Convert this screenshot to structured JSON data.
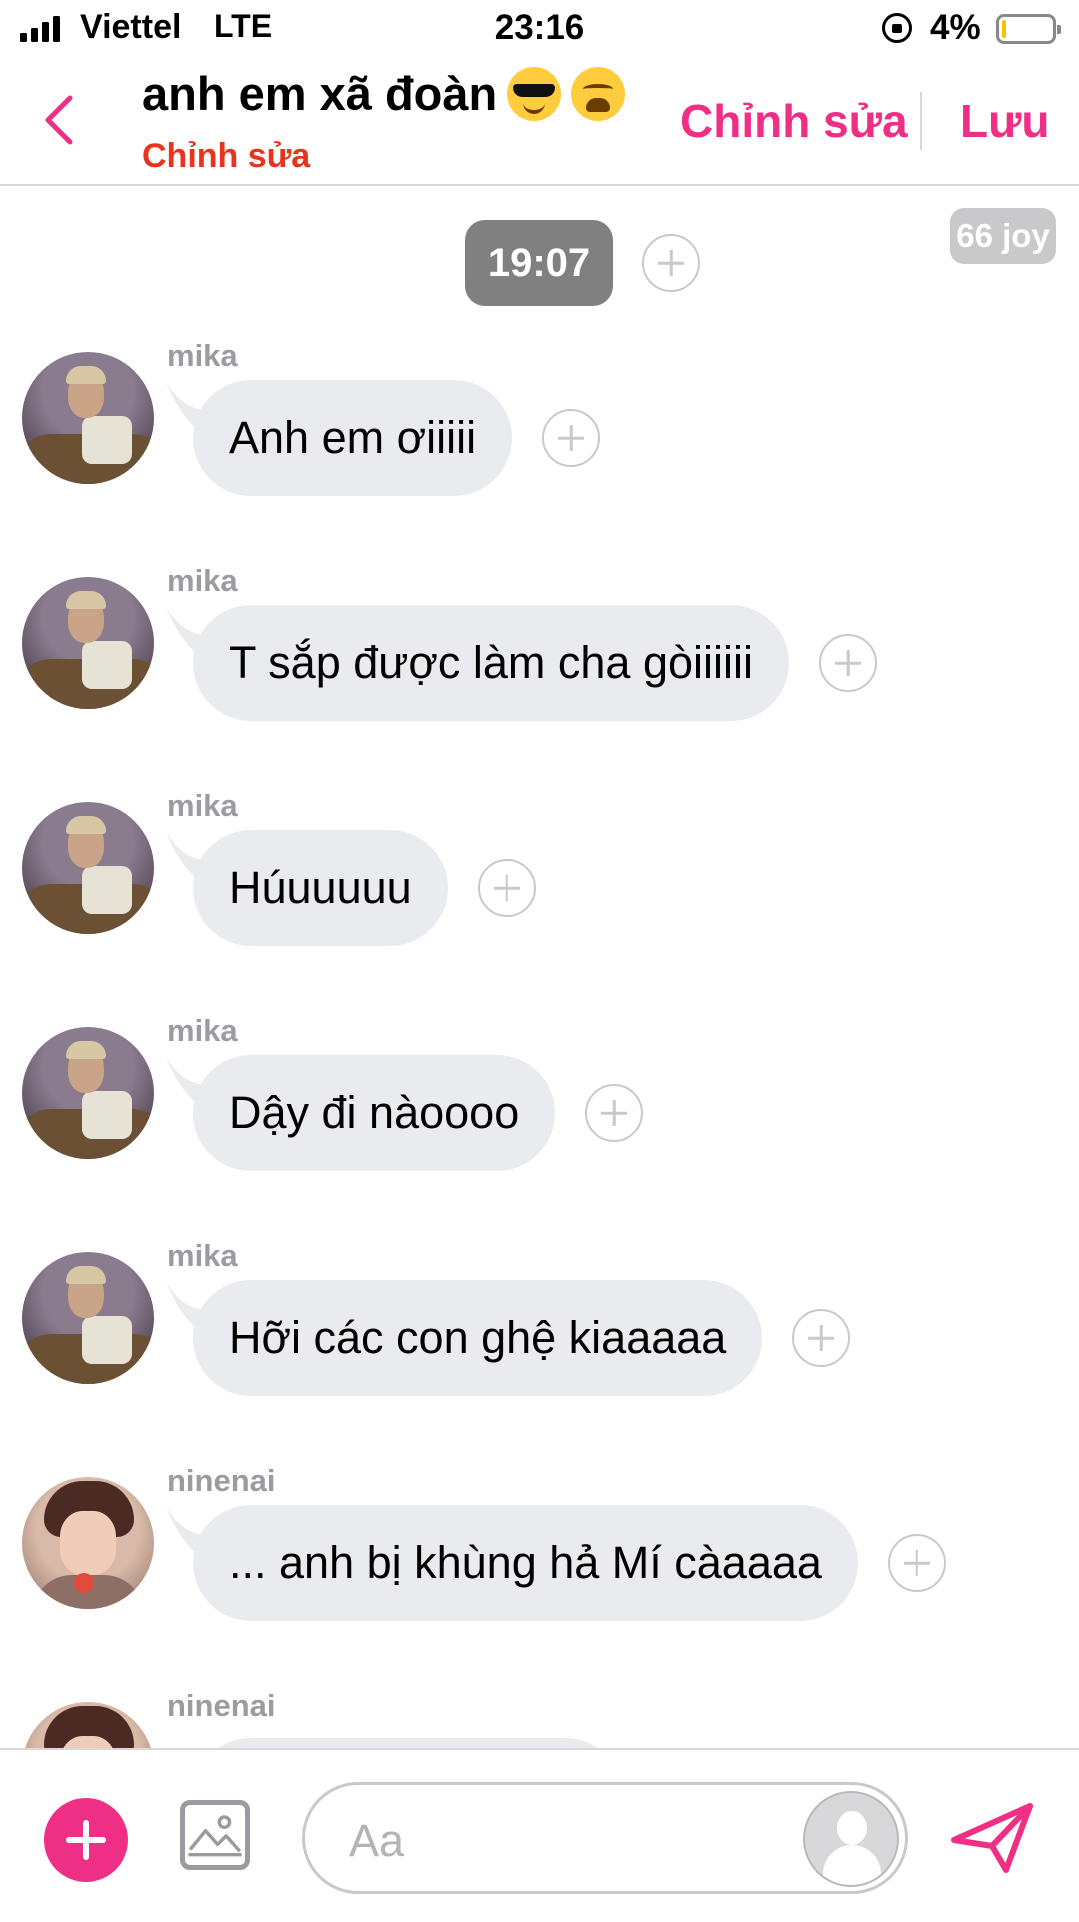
{
  "status": {
    "carrier": "Viettel",
    "network": "LTE",
    "time": "23:16",
    "battery": "4%"
  },
  "header": {
    "title": "anh em xã đoàn",
    "title_emojis": [
      "smiling-face-with-sunglasses",
      "weary-face"
    ],
    "subtitle": "Chỉnh sửa",
    "edit_label": "Chỉnh sửa",
    "save_label": "Lưu"
  },
  "chat": {
    "timestamp": "19:07",
    "joy_badge": "66 joy",
    "messages": [
      {
        "sender": "mika",
        "text": "Anh em ơiiiii"
      },
      {
        "sender": "mika",
        "text": "T sắp được làm cha gòiiiiii"
      },
      {
        "sender": "mika",
        "text": "Húuuuuu"
      },
      {
        "sender": "mika",
        "text": "Dậy đi nàoooo"
      },
      {
        "sender": "mika",
        "text": "Hỡi các con ghệ kiaaaaa"
      },
      {
        "sender": "ninenai",
        "text": "... anh bị khùng hả Mí càaaaa"
      }
    ],
    "partial_sender": "ninenai"
  },
  "composer": {
    "placeholder": "Aa"
  },
  "colors": {
    "accent": "#ef2f86",
    "subtitle": "#e8341c",
    "bubble": "#e9ebee",
    "timestamp_bg": "#808080"
  }
}
